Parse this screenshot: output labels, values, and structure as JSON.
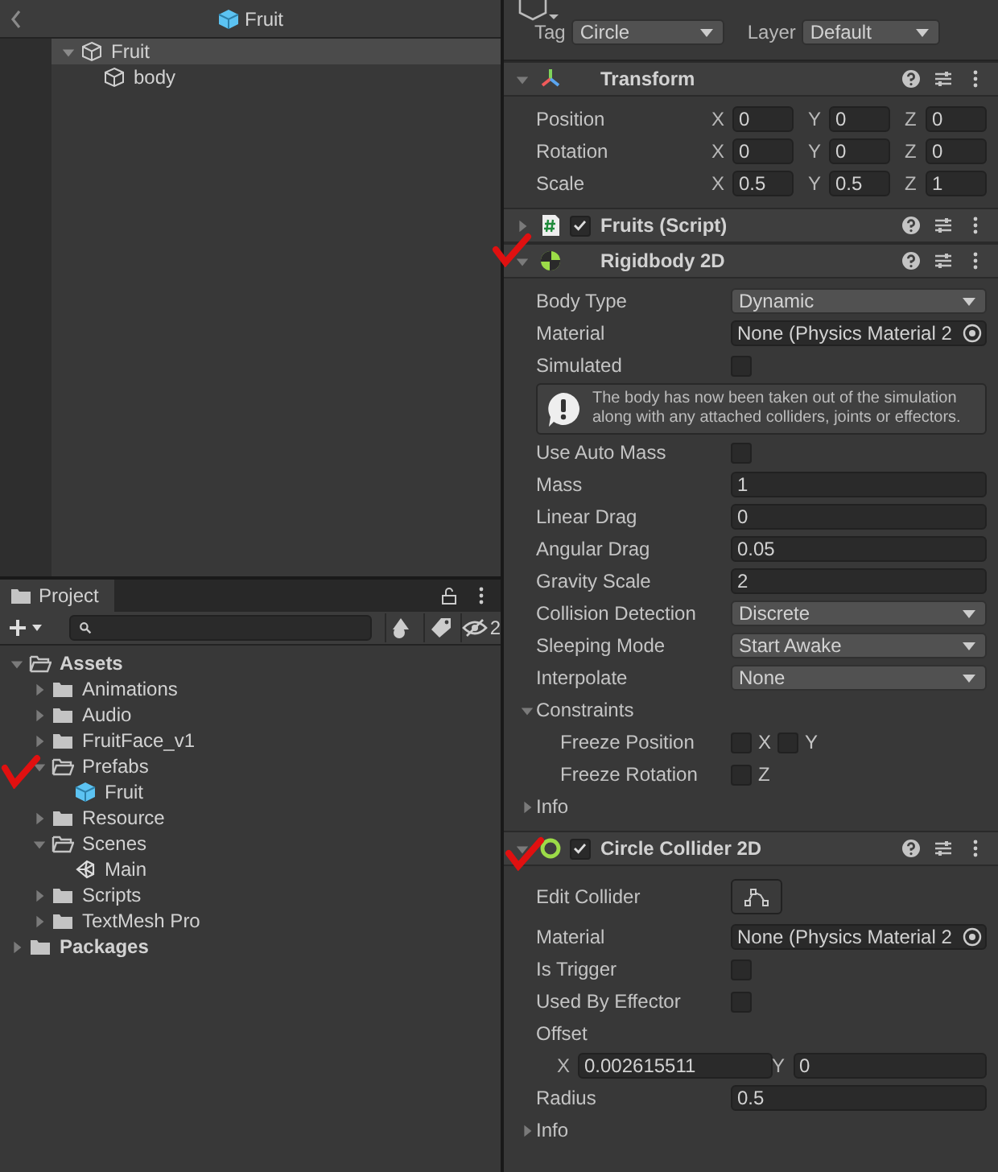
{
  "hierarchy": {
    "title": "Fruit",
    "items": [
      {
        "label": "Fruit",
        "selected": true,
        "expanded": true,
        "children": [
          {
            "label": "body",
            "selected": false
          }
        ]
      }
    ]
  },
  "project": {
    "tab": "Project",
    "hidden_count": "2",
    "tree": [
      {
        "label": "Assets",
        "kind": "folder",
        "expanded": true,
        "children": [
          {
            "label": "Animations",
            "kind": "folder",
            "expanded": false
          },
          {
            "label": "Audio",
            "kind": "folder",
            "expanded": false
          },
          {
            "label": "FruitFace_v1",
            "kind": "folder",
            "expanded": false
          },
          {
            "label": "Prefabs",
            "kind": "folder",
            "expanded": true,
            "children": [
              {
                "label": "Fruit",
                "kind": "prefab"
              }
            ]
          },
          {
            "label": "Resource",
            "kind": "folder",
            "expanded": false
          },
          {
            "label": "Scenes",
            "kind": "folder",
            "expanded": true,
            "children": [
              {
                "label": "Main",
                "kind": "scene"
              }
            ]
          },
          {
            "label": "Scripts",
            "kind": "folder",
            "expanded": false
          },
          {
            "label": "TextMesh Pro",
            "kind": "folder",
            "expanded": false
          }
        ]
      },
      {
        "label": "Packages",
        "kind": "folder",
        "expanded": false
      }
    ]
  },
  "inspector": {
    "tag": {
      "label": "Tag",
      "value": "Circle"
    },
    "layer": {
      "label": "Layer",
      "value": "Default"
    },
    "components": [
      {
        "title": "Transform",
        "expanded": true,
        "fields": [
          {
            "kind": "vector",
            "label": "Position",
            "parts": [
              {
                "axis": "X",
                "value": "0"
              },
              {
                "axis": "Y",
                "value": "0"
              },
              {
                "axis": "Z",
                "value": "0"
              }
            ]
          },
          {
            "kind": "vector",
            "label": "Rotation",
            "parts": [
              {
                "axis": "X",
                "value": "0"
              },
              {
                "axis": "Y",
                "value": "0"
              },
              {
                "axis": "Z",
                "value": "0"
              }
            ]
          },
          {
            "kind": "vector",
            "label": "Scale",
            "parts": [
              {
                "axis": "X",
                "value": "0.5"
              },
              {
                "axis": "Y",
                "value": "0.5"
              },
              {
                "axis": "Z",
                "value": "1"
              }
            ]
          }
        ]
      },
      {
        "title": "Fruits (Script)",
        "expanded": false,
        "enabled": true
      },
      {
        "title": "Rigidbody 2D",
        "expanded": true,
        "fields": [
          {
            "kind": "dropdown",
            "label": "Body Type",
            "value": "Dynamic"
          },
          {
            "kind": "object",
            "label": "Material",
            "value": "None (Physics Material 2"
          },
          {
            "kind": "checkbox",
            "label": "Simulated",
            "checked": false
          },
          {
            "kind": "help",
            "text": "The body has now been taken out of the simulation along with any attached colliders, joints or effectors."
          },
          {
            "kind": "checkbox",
            "label": "Use Auto Mass",
            "checked": false
          },
          {
            "kind": "number",
            "label": "Mass",
            "value": "1"
          },
          {
            "kind": "number",
            "label": "Linear Drag",
            "value": "0"
          },
          {
            "kind": "number",
            "label": "Angular Drag",
            "value": "0.05"
          },
          {
            "kind": "number",
            "label": "Gravity Scale",
            "value": "2"
          },
          {
            "kind": "dropdown",
            "label": "Collision Detection",
            "value": "Discrete"
          },
          {
            "kind": "dropdown",
            "label": "Sleeping Mode",
            "value": "Start Awake"
          },
          {
            "kind": "dropdown",
            "label": "Interpolate",
            "value": "None"
          },
          {
            "kind": "foldout",
            "label": "Constraints",
            "expanded": true,
            "children": [
              {
                "kind": "axis_checks",
                "label": "Freeze Position",
                "parts": [
                  {
                    "axis": "X",
                    "checked": false
                  },
                  {
                    "axis": "Y",
                    "checked": false
                  }
                ]
              },
              {
                "kind": "axis_checks",
                "label": "Freeze Rotation",
                "parts": [
                  {
                    "axis": "Z",
                    "checked": false
                  }
                ]
              }
            ]
          },
          {
            "kind": "foldout",
            "label": "Info",
            "expanded": false
          }
        ]
      },
      {
        "title": "Circle Collider 2D",
        "expanded": true,
        "enabled": true,
        "fields": [
          {
            "kind": "button",
            "label": "Edit Collider"
          },
          {
            "kind": "object",
            "label": "Material",
            "value": "None (Physics Material 2"
          },
          {
            "kind": "checkbox",
            "label": "Is Trigger",
            "checked": false
          },
          {
            "kind": "checkbox",
            "label": "Used By Effector",
            "checked": false
          },
          {
            "kind": "vector2",
            "label": "Offset",
            "parts": [
              {
                "axis": "X",
                "value": "0.002615511"
              },
              {
                "axis": "Y",
                "value": "0"
              }
            ]
          },
          {
            "kind": "number",
            "label": "Radius",
            "value": "0.5"
          },
          {
            "kind": "foldout",
            "label": "Info",
            "expanded": false
          }
        ]
      }
    ]
  }
}
